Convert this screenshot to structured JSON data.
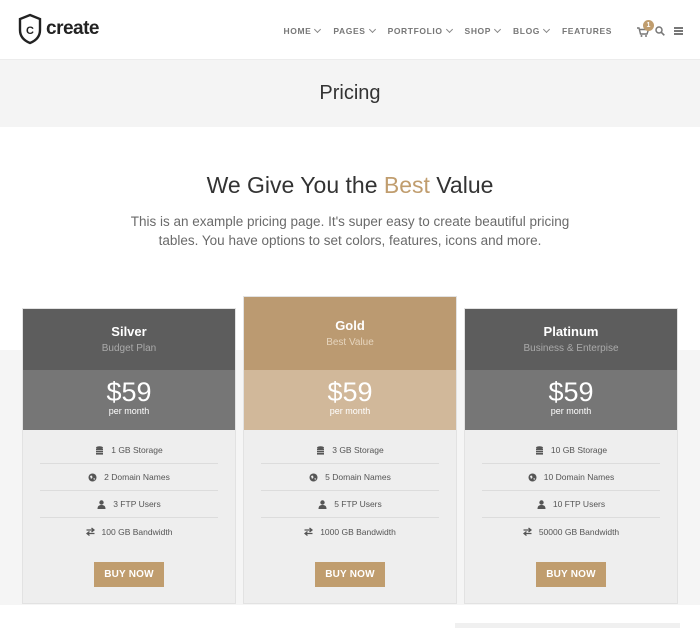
{
  "brand": {
    "name": "create",
    "logo_letter": "C"
  },
  "nav": {
    "items": [
      {
        "label": "HOME",
        "dropdown": true
      },
      {
        "label": "PAGES",
        "dropdown": true
      },
      {
        "label": "PORTFOLIO",
        "dropdown": true
      },
      {
        "label": "SHOP",
        "dropdown": true
      },
      {
        "label": "BLOG",
        "dropdown": true
      },
      {
        "label": "FEATURES",
        "dropdown": false
      }
    ],
    "cart_count": "1",
    "icons": [
      "cart-icon",
      "search-icon",
      "menu-icon"
    ]
  },
  "page_title": "Pricing",
  "headline": {
    "before": "We Give You the ",
    "accent": "Best",
    "after": " Value"
  },
  "intro": "This is an example pricing page. It's super easy to create beautiful pricing tables. You have options to set colors, features, icons and more.",
  "colors": {
    "accent": "#c09d6e",
    "dark_header": "#5d5d5d",
    "dark_price": "#767676",
    "gold_header": "#bb9a71",
    "gold_price": "#d1b89a"
  },
  "plans": [
    {
      "name": "Silver",
      "subtitle": "Budget Plan",
      "price": "$59",
      "period": "per month",
      "features": [
        "1 GB Storage",
        "2 Domain Names",
        "3 FTP Users",
        "100 GB Bandwidth"
      ],
      "button": "BUY NOW"
    },
    {
      "name": "Gold",
      "subtitle": "Best Value",
      "price": "$59",
      "period": "per month",
      "features": [
        "3 GB Storage",
        "5 Domain Names",
        "5 FTP Users",
        "1000 GB Bandwidth"
      ],
      "button": "BUY NOW"
    },
    {
      "name": "Platinum",
      "subtitle": "Business & Enterpise",
      "price": "$59",
      "period": "per month",
      "features": [
        "10 GB Storage",
        "10 Domain Names",
        "10 FTP Users",
        "50000 GB Bandwidth"
      ],
      "button": "BUY NOW"
    }
  ],
  "feature_icons": [
    "database-icon",
    "globe-icon",
    "user-icon",
    "exchange-icon"
  ]
}
